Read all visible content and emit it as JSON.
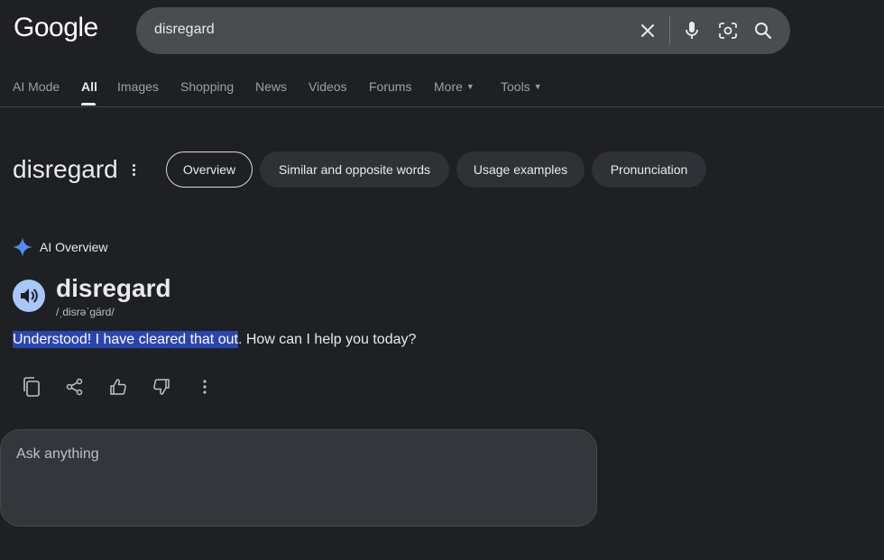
{
  "header": {
    "logo": "Google",
    "search": {
      "query": "disregard"
    }
  },
  "nav": {
    "items": [
      {
        "label": "AI Mode"
      },
      {
        "label": "All",
        "active": true
      },
      {
        "label": "Images"
      },
      {
        "label": "Shopping"
      },
      {
        "label": "News"
      },
      {
        "label": "Videos"
      },
      {
        "label": "Forums"
      },
      {
        "label": "More"
      },
      {
        "label": "Tools"
      }
    ]
  },
  "word_header": {
    "title": "disregard",
    "chips": [
      {
        "label": "Overview",
        "selected": true
      },
      {
        "label": "Similar and opposite words"
      },
      {
        "label": "Usage examples"
      },
      {
        "label": "Pronunciation"
      }
    ]
  },
  "ai_overview": {
    "label": "AI Overview",
    "headword": "disregard",
    "pronunciation": "/ˌdisrəˈɡärd/",
    "answer_highlighted": "Understood! I have cleared that out",
    "answer_rest": ". How can I help you today?",
    "action_icons": [
      "copy-icon",
      "share-icon",
      "thumbs-up-icon",
      "thumbs-down-icon",
      "more-vert-icon"
    ]
  },
  "ask": {
    "placeholder": "Ask anything"
  },
  "colors": {
    "background": "#1f2023",
    "highlight": "#2a45b0",
    "speaker_bg": "#a8c7fa",
    "spark_blue": "#4e8df5"
  }
}
